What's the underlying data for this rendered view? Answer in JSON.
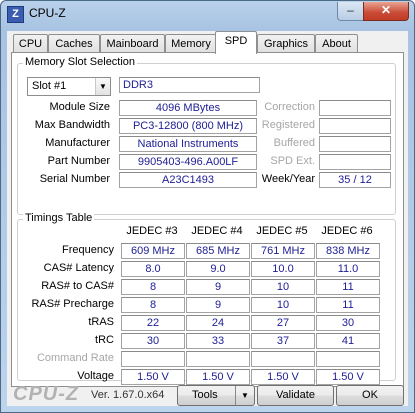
{
  "window": {
    "title": "CPU-Z",
    "icon_glyph": "Z",
    "minimize_glyph": "–",
    "close_glyph": "✕"
  },
  "tabs": [
    {
      "label": "CPU"
    },
    {
      "label": "Caches"
    },
    {
      "label": "Mainboard"
    },
    {
      "label": "Memory"
    },
    {
      "label": "SPD",
      "active": true
    },
    {
      "label": "Graphics"
    },
    {
      "label": "About"
    }
  ],
  "slot": {
    "legend": "Memory Slot Selection",
    "selected": "Slot #1",
    "type": "DDR3",
    "fields": [
      {
        "label": "Module Size",
        "value": "4096 MBytes"
      },
      {
        "label": "Max Bandwidth",
        "value": "PC3-12800 (800 MHz)"
      },
      {
        "label": "Manufacturer",
        "value": "National Instruments"
      },
      {
        "label": "Part Number",
        "value": "9905403-496.A00LF"
      },
      {
        "label": "Serial Number",
        "value": "A23C1493"
      }
    ],
    "right_fields": [
      {
        "label": "Correction",
        "value": ""
      },
      {
        "label": "Registered",
        "value": ""
      },
      {
        "label": "Buffered",
        "value": ""
      },
      {
        "label": "SPD Ext.",
        "value": ""
      }
    ],
    "week_year_label": "Week/Year",
    "week_year": "35 / 12"
  },
  "timings": {
    "legend": "Timings Table",
    "columns": [
      "JEDEC #3",
      "JEDEC #4",
      "JEDEC #5",
      "JEDEC #6"
    ],
    "rows": [
      {
        "label": "Frequency",
        "values": [
          "609 MHz",
          "685 MHz",
          "761 MHz",
          "838 MHz"
        ]
      },
      {
        "label": "CAS# Latency",
        "values": [
          "8.0",
          "9.0",
          "10.0",
          "11.0"
        ]
      },
      {
        "label": "RAS# to CAS#",
        "values": [
          "8",
          "9",
          "10",
          "11"
        ]
      },
      {
        "label": "RAS# Precharge",
        "values": [
          "8",
          "9",
          "10",
          "11"
        ]
      },
      {
        "label": "tRAS",
        "values": [
          "22",
          "24",
          "27",
          "30"
        ]
      },
      {
        "label": "tRC",
        "values": [
          "30",
          "33",
          "37",
          "41"
        ]
      },
      {
        "label": "Command Rate",
        "values": [
          "",
          "",
          "",
          ""
        ],
        "disabled": true
      },
      {
        "label": "Voltage",
        "values": [
          "1.50 V",
          "1.50 V",
          "1.50 V",
          "1.50 V"
        ]
      }
    ]
  },
  "footer": {
    "brand": "CPU-Z",
    "version": "Ver. 1.67.0.x64",
    "tools_label": "Tools",
    "validate_label": "Validate",
    "ok_label": "OK"
  }
}
